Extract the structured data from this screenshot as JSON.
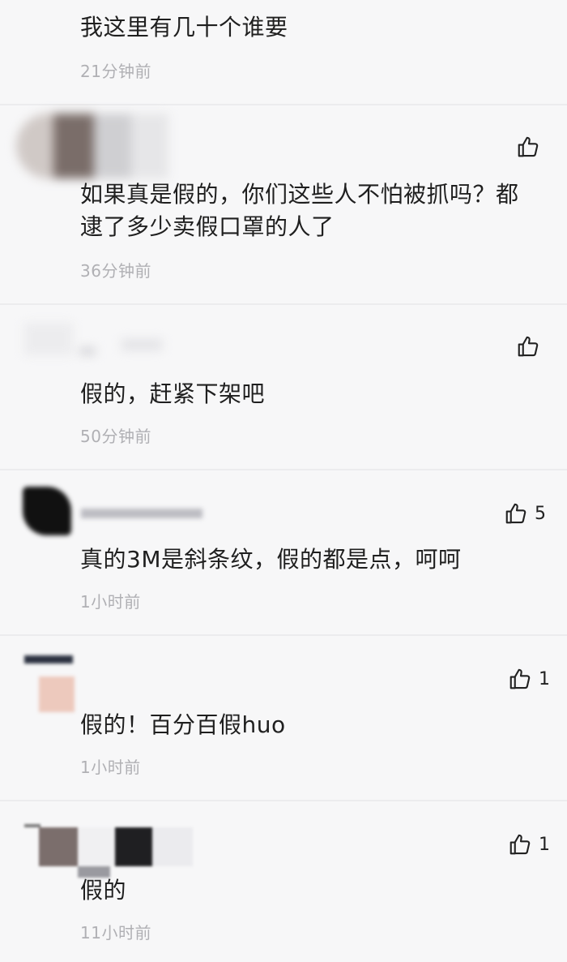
{
  "comments": [
    {
      "text": "我这里有几十个谁要",
      "time": "21分钟前",
      "likes": ""
    },
    {
      "text": "如果真是假的，你们这些人不怕被抓吗？都逮了多少卖假口罩的人了",
      "time": "36分钟前",
      "likes": ""
    },
    {
      "text": "假的，赶紧下架吧",
      "time": "50分钟前",
      "likes": ""
    },
    {
      "text": "真的3M是斜条纹，假的都是点，呵呵",
      "time": "1小时前",
      "likes": "5"
    },
    {
      "text": "假的！百分百假huo",
      "time": "1小时前",
      "likes": "1"
    },
    {
      "text": "假的",
      "time": "11小时前",
      "likes": "1"
    }
  ],
  "icons": {
    "like": "thumbs-up-icon"
  },
  "colors": {
    "background": "#f7f7f8",
    "text": "#1f1f1f",
    "timestamp": "#b0b0b4",
    "divider": "#ececee"
  }
}
